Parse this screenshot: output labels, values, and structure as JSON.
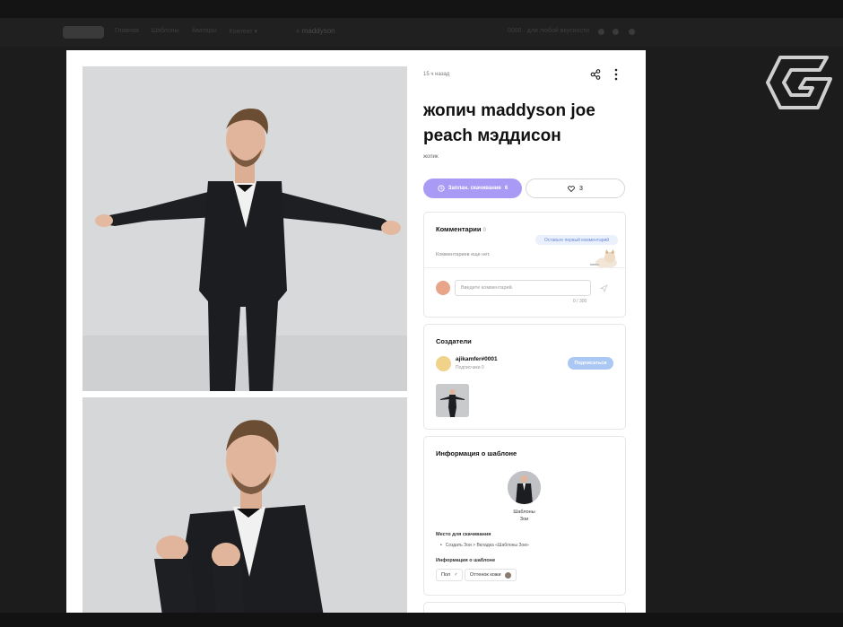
{
  "background": {
    "nav_links": [
      "Главная",
      "Шаблоны",
      "Аватары",
      "Контент ▾"
    ],
    "search_text": "maddyson",
    "right_text": "0000 · для любой вкусности"
  },
  "post": {
    "time": "15 ч назад",
    "title": "жопич maddyson joe peach мэддисон",
    "subtitle": "жопик",
    "download_label": "Заплан. скачивание",
    "download_count": "6",
    "like_count": "3"
  },
  "comments": {
    "heading": "Комментарии",
    "count": "0",
    "first_comment_hint": "Оставьте первый комментарий",
    "empty_text": "Комментариев еще нет.",
    "input_placeholder": "Введите комментарий.",
    "counter": "0 / 300"
  },
  "creators": {
    "heading": "Создатели",
    "name": "ajikamfer#0001",
    "subscribers": "Подписчики 0",
    "subscribe_label": "Подписаться"
  },
  "template_info": {
    "heading": "Информация о шаблоне",
    "template_label_line1": "Шаблоны",
    "template_label_line2": "Зои",
    "location_heading": "Место для скачивания",
    "location_path": "Создать Зои > Вкладка «Шаблоны Зои»",
    "info_heading": "Информация о шаблоне",
    "gender_label": "Пол",
    "gender_symbol": "♂",
    "skin_label": "Оттенок кожи"
  },
  "colors": {
    "accent_download": "#a99bf5",
    "subscribe": "#aac8f3",
    "skin_tone": "#8b7a6e"
  }
}
